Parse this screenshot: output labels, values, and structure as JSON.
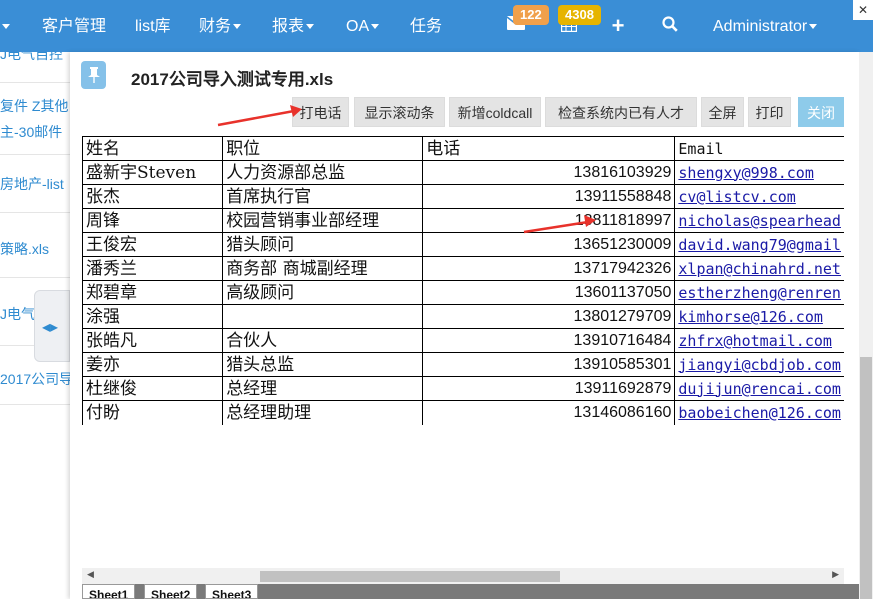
{
  "navbar": {
    "items": [
      {
        "label": "客户管理",
        "dropdown": false
      },
      {
        "label": "list库",
        "dropdown": false
      },
      {
        "label": "财务",
        "dropdown": true
      },
      {
        "label": "报表",
        "dropdown": true
      },
      {
        "label": "OA",
        "dropdown": true
      },
      {
        "label": "任务",
        "dropdown": false
      }
    ],
    "mail_badge": "122",
    "calendar_badge": "4308",
    "user": "Administrator",
    "colors": {
      "bar": "#3a8ed6",
      "badge_orange": "#f0a04b",
      "badge_yellow": "#e6b400"
    }
  },
  "background_list": {
    "items": [
      "J电气自控",
      "复件 Z其他",
      "主-30邮件",
      "房地产-list",
      "策略.xls",
      "J电气",
      "2017公司导"
    ]
  },
  "modal": {
    "title": "2017公司导入测试专用.xls",
    "toolbar": {
      "call": "打电话",
      "scroll_bar": "显示滚动条",
      "add_coldcall": "新增coldcall",
      "check_talent": "检查系统内已有人才",
      "fullscreen": "全屏",
      "print": "打印",
      "close": "关闭"
    },
    "sheet": {
      "headers": [
        "姓名",
        "职位",
        "电话",
        "Email"
      ],
      "rows": [
        [
          "盛新宇Steven",
          "人力资源部总监",
          "13816103929",
          "shengxy@998.com"
        ],
        [
          "张杰",
          "首席执行官",
          "13911558848",
          "cv@listcv.com"
        ],
        [
          "周锋",
          "校园营销事业部经理",
          "13811818997",
          "nicholas@spearhead"
        ],
        [
          "王俊宏",
          "猎头顾问",
          "13651230009",
          "david.wang79@gmail"
        ],
        [
          "潘秀兰",
          "商务部 商城副经理",
          "13717942326",
          "xlpan@chinahrd.net"
        ],
        [
          "郑碧章",
          "高级顾问",
          "13601137050",
          "estherzheng@renren"
        ],
        [
          "涂强",
          "",
          "13801279709",
          "kimhorse@126.com"
        ],
        [
          "张皓凡",
          "合伙人",
          "13910716484",
          "zhfrx@hotmail.com"
        ],
        [
          "姜亦",
          "猎头总监",
          "13910585301",
          "jiangyi@cbdjob.com"
        ],
        [
          "杜继俊",
          "总经理",
          "13911692879",
          "dujijun@rencai.com"
        ],
        [
          "付盼",
          "总经理助理",
          "13146086160",
          "baobeichen@126.com"
        ]
      ],
      "tabs": [
        "Sheet1",
        "Sheet2",
        "Sheet3"
      ]
    }
  }
}
